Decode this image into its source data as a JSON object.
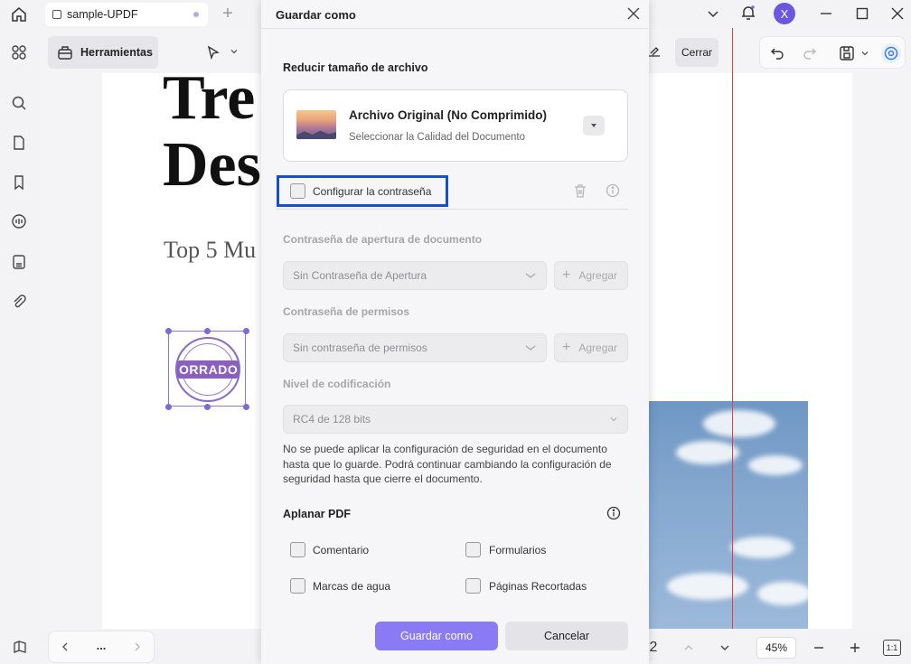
{
  "app": {
    "tab_title": "sample-UPDF",
    "user_initial": "X",
    "accent_color": "#8a7af4"
  },
  "toolbar": {
    "tools_label": "Herramientas",
    "close_label": "Cerrar"
  },
  "document": {
    "title_line1": "Tre",
    "title_line2": "Des",
    "subtitle": "Top 5 Mu",
    "stamp_text": "ORRADO"
  },
  "bottom": {
    "page_fragment": "2",
    "zoom": "45%",
    "fit_label": "1:1",
    "more": "..."
  },
  "dialog": {
    "title": "Guardar como",
    "reduce_section_title": "Reducir tamaño de archivo",
    "file_option_name": "Archivo Original (No Comprimido)",
    "file_option_desc": "Seleccionar la Calidad del Documento",
    "configure_password_label": "Configurar la contraseña",
    "open_password_title": "Contraseña de apertura de documento",
    "open_password_select": "Sin Contraseña de Apertura",
    "add_label_1": "Agregar",
    "permissions_title": "Contraseña de permisos",
    "permissions_select": "Sin contraseña de permisos",
    "add_label_2": "Agregar",
    "encoding_title": "Nivel de codificación",
    "encoding_select": "RC4 de 128 bits",
    "security_note": "No se puede aplicar la configuración de seguridad en el documento hasta que lo guarde. Podrá continuar cambiando la configuración de seguridad hasta que cierre el documento.",
    "flatten_title": "Aplanar PDF",
    "flatten_options": [
      "Comentario",
      "Formularios",
      "Marcas de agua",
      "Páginas Recortadas"
    ],
    "save_label": "Guardar como",
    "cancel_label": "Cancelar",
    "highlight_color": "#1550c8"
  }
}
